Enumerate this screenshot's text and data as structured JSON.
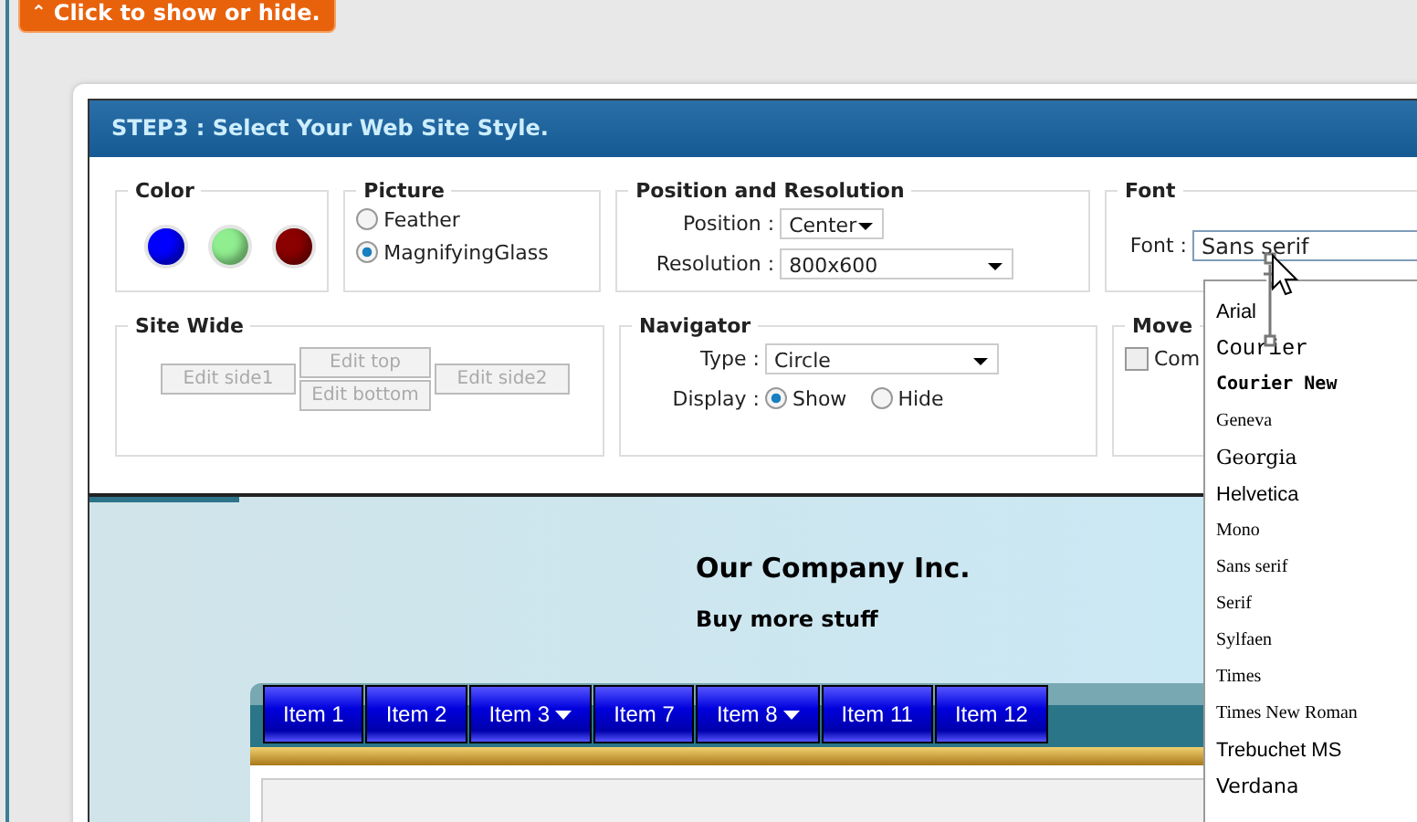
{
  "toggle_tab": {
    "label": "Click to show or hide.",
    "icon": "⌃"
  },
  "dialog": {
    "title": "STEP3 : Select Your Web Site Style."
  },
  "color_group": {
    "legend": "Color",
    "swatches": [
      {
        "color": "#0000ff",
        "selected": false
      },
      {
        "color": "#90ee90",
        "selected": false
      },
      {
        "color": "#8b0000",
        "selected": false
      }
    ]
  },
  "picture_group": {
    "legend": "Picture",
    "options": [
      {
        "label": "Feather",
        "selected": false
      },
      {
        "label": "MagnifyingGlass",
        "selected": true
      }
    ]
  },
  "position_group": {
    "legend": "Position and Resolution",
    "fields": [
      {
        "label": "Position :",
        "value": "Center",
        "kind": "short"
      },
      {
        "label": "Resolution :",
        "value": "800x600",
        "kind": "long"
      }
    ]
  },
  "font_group": {
    "legend": "Font",
    "label": "Font :",
    "value": "Sans serif",
    "options": [
      {
        "label": "Arial",
        "kind": "arial"
      },
      {
        "label": "Courier",
        "kind": "courier"
      },
      {
        "label": "Courier New",
        "kind": "couriernew"
      },
      {
        "label": "Geneva",
        "kind": "serif-small"
      },
      {
        "label": "Georgia",
        "kind": "georgia"
      },
      {
        "label": "Helvetica",
        "kind": "arial"
      },
      {
        "label": "Mono",
        "kind": "serif-small"
      },
      {
        "label": "Sans serif",
        "kind": "serif-small"
      },
      {
        "label": "Serif",
        "kind": "serif-small"
      },
      {
        "label": "Sylfaen",
        "kind": "serif-small"
      },
      {
        "label": "Times",
        "kind": "serif-small"
      },
      {
        "label": "Times New Roman",
        "kind": "serif-small"
      },
      {
        "label": "Trebuchet MS",
        "kind": "arial"
      },
      {
        "label": "Verdana",
        "kind": "verdana"
      }
    ]
  },
  "site_wide_group": {
    "legend": "Site Wide",
    "buttons": [
      {
        "label": "Edit side1",
        "kind": "left"
      },
      {
        "label": "Edit top",
        "kind": "top"
      },
      {
        "label": "Edit bottom",
        "kind": "bottom"
      },
      {
        "label": "Edit side2",
        "kind": "right"
      }
    ]
  },
  "navigator_group": {
    "legend": "Navigator",
    "type_label": "Type :",
    "type_value": "Circle",
    "display_label": "Display :",
    "display_options": [
      {
        "label": "Show",
        "selected": true
      },
      {
        "label": "Hide",
        "selected": false
      }
    ]
  },
  "move_group": {
    "legend": "Move",
    "checkbox": {
      "label": "Com",
      "checked": false
    }
  },
  "preview": {
    "company": "Our Company Inc.",
    "tagline": "Buy more stuff",
    "menu": [
      {
        "label": "Item 1",
        "has_submenu": false
      },
      {
        "label": "Item 2",
        "has_submenu": false
      },
      {
        "label": "Item 3",
        "has_submenu": true
      },
      {
        "label": "Item 7",
        "has_submenu": false
      },
      {
        "label": "Item 8",
        "has_submenu": true
      },
      {
        "label": "Item 11",
        "has_submenu": false
      },
      {
        "label": "Item 12",
        "has_submenu": false
      }
    ]
  }
}
